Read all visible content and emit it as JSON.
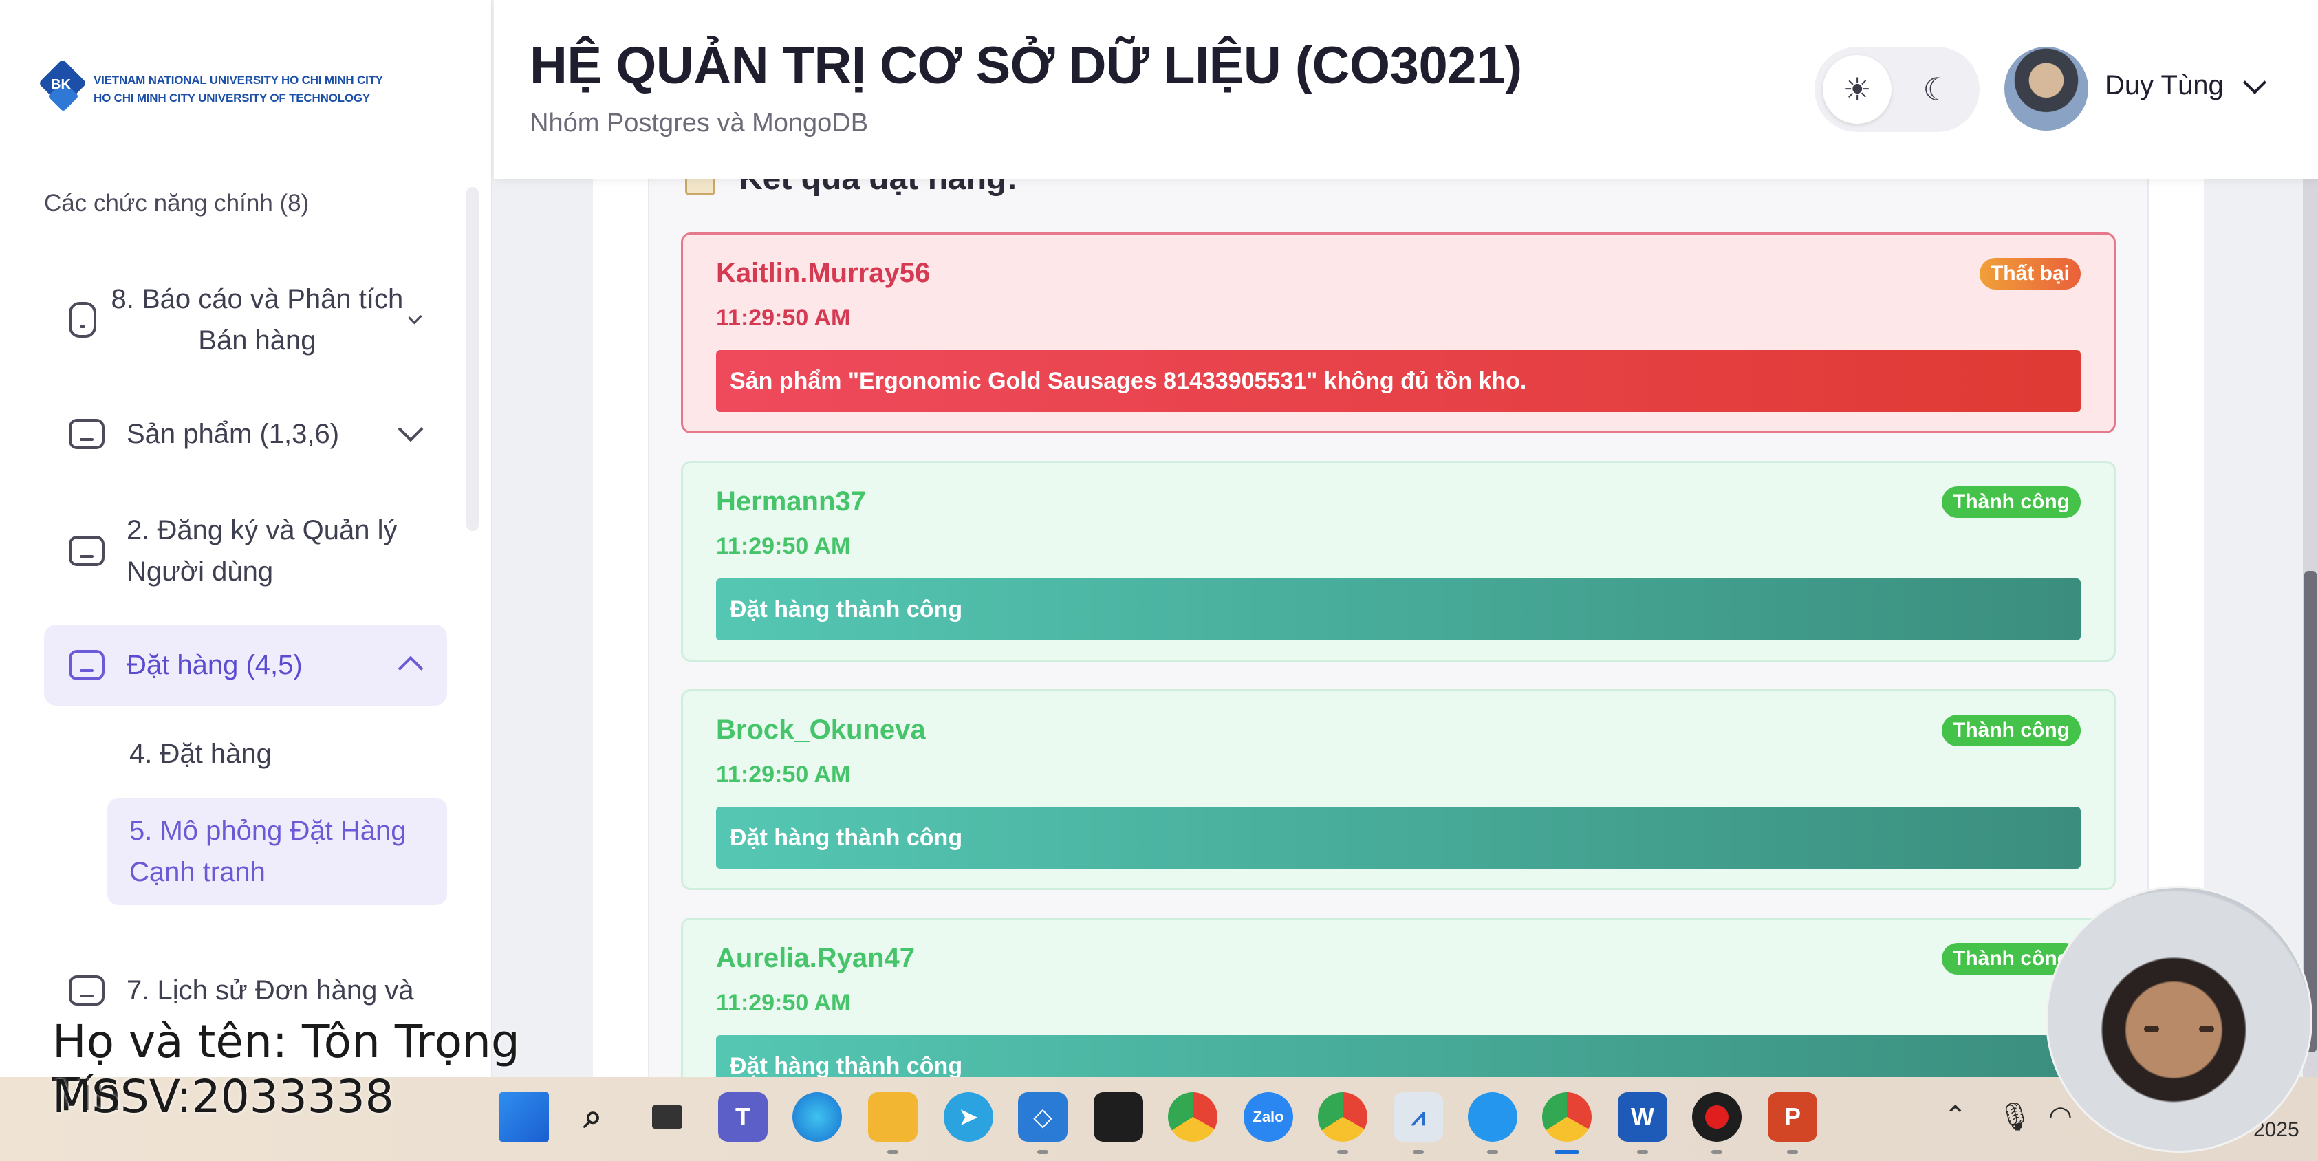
{
  "sidebar": {
    "logo_line1": "VIETNAM NATIONAL UNIVERSITY HO CHI MINH CITY",
    "logo_line2": "HO CHI MINH CITY UNIVERSITY OF TECHNOLOGY",
    "logo_mark": "BK",
    "section_title": "Các chức năng chính (8)",
    "items": [
      {
        "label": "8. Báo cáo và Phân tích Bán hàng",
        "icon": "hexagon-icon",
        "expanded": false
      },
      {
        "label": "Sản phẩm (1,3,6)",
        "icon": "box-icon",
        "expanded": false
      },
      {
        "label": "2. Đăng ký và Quản lý Người dùng",
        "icon": "box-icon",
        "expanded": false
      },
      {
        "label": "Đặt hàng (4,5)",
        "icon": "box-icon",
        "expanded": true,
        "active": true
      },
      {
        "label": "7. Lịch sử Đơn hàng và",
        "icon": "box-icon",
        "expanded": false
      }
    ],
    "sub_items": [
      {
        "label": "4. Đặt hàng",
        "active": false
      },
      {
        "label": "5. Mô phỏng Đặt Hàng Cạnh tranh",
        "active": true
      }
    ]
  },
  "header": {
    "title": "HỆ QUẢN TRỊ CƠ SỞ DỮ LIỆU (CO3021)",
    "subtitle": "Nhóm Postgres và MongoDB",
    "theme_light_icon": "sun-icon",
    "theme_dark_icon": "moon-icon",
    "user_name": "Duy Tùng"
  },
  "results": {
    "heading": "Kết quả đặt hàng:",
    "items": [
      {
        "user": "Kaitlin.Murray56",
        "time": "11:29:50 AM",
        "status": "Thất bại",
        "message": "Sản phẩm \"Ergonomic Gold Sausages 81433905531\" không đủ tồn kho.",
        "type": "fail"
      },
      {
        "user": "Hermann37",
        "time": "11:29:50 AM",
        "status": "Thành công",
        "message": "Đặt hàng thành công",
        "type": "ok"
      },
      {
        "user": "Brock_Okuneva",
        "time": "11:29:50 AM",
        "status": "Thành công",
        "message": "Đặt hàng thành công",
        "type": "ok"
      },
      {
        "user": "Aurelia.Ryan47",
        "time": "11:29:50 AM",
        "status": "Thành công",
        "message": "Đặt hàng thành công",
        "type": "ok"
      }
    ]
  },
  "overlay": {
    "name_line": "Họ và tên: Tôn Trọng Tín",
    "id_line": "MSSV:2033338"
  },
  "taskbar": {
    "apps": [
      "windows-start-icon",
      "search-icon",
      "task-view-icon",
      "teams-icon",
      "edge-icon",
      "file-explorer-icon",
      "telegram-icon",
      "vscode-icon",
      "figma-icon",
      "chrome-icon",
      "zalo-icon",
      "chrome-profile-icon",
      "resource-monitor-icon",
      "docker-icon",
      "chrome-active-icon",
      "word-icon",
      "record-icon",
      "powerpoint-icon"
    ],
    "zalo_label": "Zalo",
    "word_label": "W",
    "ppt_label": "P",
    "tray_year": "2025"
  },
  "colors": {
    "accent": "#6b5bd6",
    "fail": "#d63a52",
    "success": "#46c46a",
    "success_bar": "#3b8e7e"
  }
}
